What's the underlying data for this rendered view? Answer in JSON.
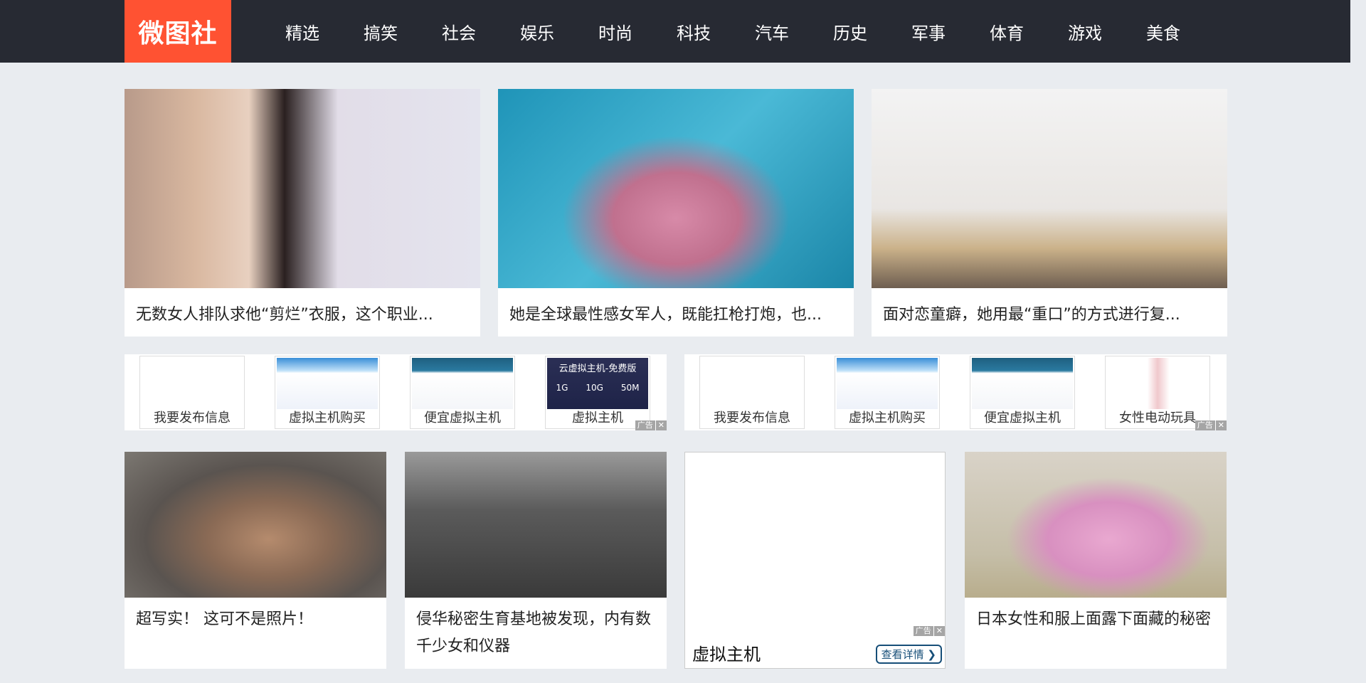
{
  "header": {
    "logo": "微图社",
    "nav": [
      "精选",
      "搞笑",
      "社会",
      "娱乐",
      "时尚",
      "科技",
      "汽车",
      "历史",
      "军事",
      "体育",
      "游戏",
      "美食"
    ]
  },
  "row1": [
    {
      "title": "无数女人排队求他“剪烂”衣服，这个职业...",
      "image": "woman-black-swimsuit"
    },
    {
      "title": "她是全球最性感女军人，既能扛枪打炮，也...",
      "image": "woman-pool-float"
    },
    {
      "title": "面对恋童癖，她用最“重口”的方式进行复...",
      "image": "woman-white-dress"
    }
  ],
  "ad_banners": [
    {
      "items": [
        "我要发布信息",
        "虚拟主机购买",
        "便宜虚拟主机",
        "虚拟主机"
      ],
      "ad_label": "广告",
      "close": "✕",
      "promo": {
        "title": "云虚拟主机-免费版",
        "specs": [
          "1G",
          "10G",
          "50M"
        ]
      }
    },
    {
      "items": [
        "我要发布信息",
        "虚拟主机购买",
        "便宜虚拟主机",
        "女性电动玩具"
      ],
      "ad_label": "广告",
      "close": "✕"
    }
  ],
  "row2": [
    {
      "title": "超写实！ 这可不是照片！",
      "image": "painting-woman-back"
    },
    {
      "title": "侵华秘密生育基地被发现，内有数千少女和仪器",
      "image": "historical-photo-women"
    },
    {
      "ad": true,
      "title": "虚拟主机",
      "button": "查看详情 ❯",
      "ad_label": "广告",
      "close": "✕"
    },
    {
      "title": "日本女性和服上面露下面藏的秘密",
      "image": "woman-pink-kimono"
    }
  ],
  "colors": {
    "header": "#272a33",
    "logo": "#ff5232",
    "background": "#e9ecf0"
  }
}
